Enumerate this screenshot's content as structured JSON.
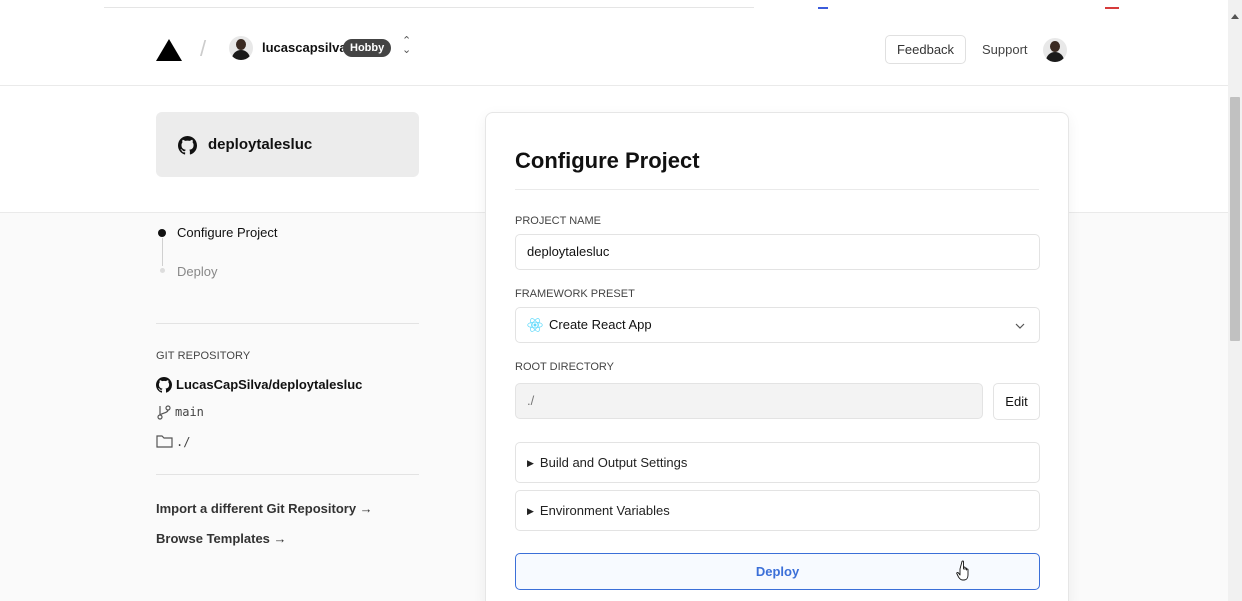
{
  "header": {
    "username": "lucascapsilva",
    "plan_badge": "Hobby",
    "feedback_label": "Feedback",
    "support_label": "Support"
  },
  "repo_card": {
    "name": "deploytalesluc"
  },
  "steps": [
    {
      "label": "Configure Project",
      "active": true
    },
    {
      "label": "Deploy",
      "active": false
    }
  ],
  "git_repository": {
    "label": "GIT REPOSITORY",
    "repo": "LucasCapSilva/deploytalesluc",
    "branch": "main",
    "directory": "./"
  },
  "links": {
    "import": "Import a different Git Repository →",
    "templates": "Browse Templates →"
  },
  "form": {
    "title": "Configure Project",
    "project_name_label": "PROJECT NAME",
    "project_name_value": "deploytalesluc",
    "framework_label": "FRAMEWORK PRESET",
    "framework_value": "Create React App",
    "root_label": "ROOT DIRECTORY",
    "root_value": "./",
    "edit_label": "Edit",
    "build_settings_label": "Build and Output Settings",
    "env_vars_label": "Environment Variables",
    "deploy_label": "Deploy"
  },
  "colors": {
    "accent": "#3b6fd8",
    "badge": "#444444",
    "react": "#61dafb"
  }
}
